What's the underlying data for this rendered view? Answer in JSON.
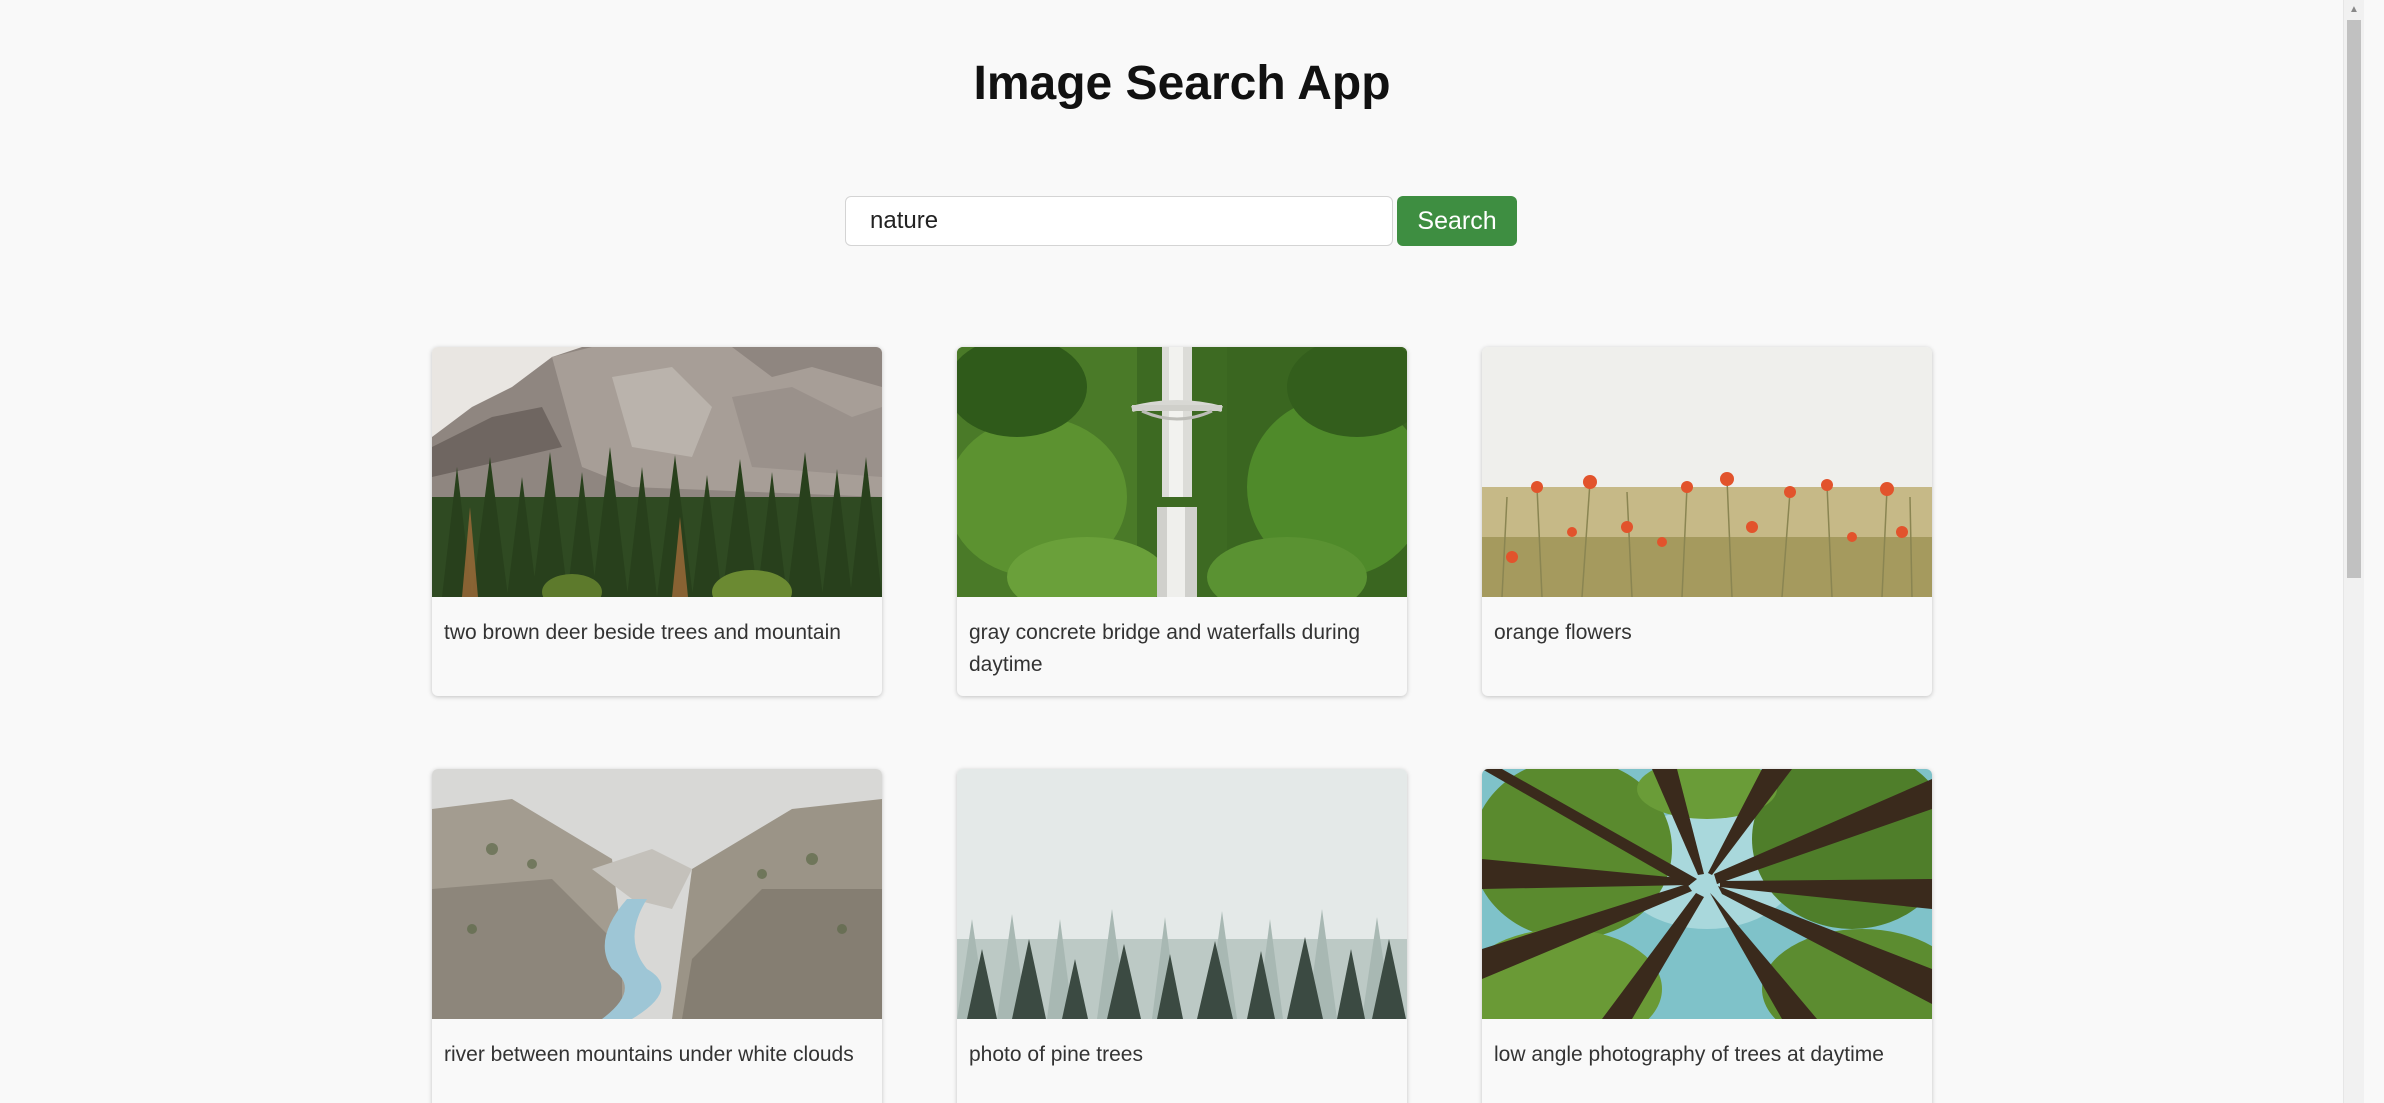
{
  "app": {
    "title": "Image Search App"
  },
  "search": {
    "value": "nature",
    "button_label": "Search"
  },
  "results": [
    {
      "caption": "two brown deer beside trees and mountain",
      "image": "mountain-forest-image"
    },
    {
      "caption": "gray concrete bridge and waterfalls during daytime",
      "image": "waterfall-bridge-image"
    },
    {
      "caption": "orange flowers",
      "image": "poppy-field-image"
    },
    {
      "caption": "river between mountains under white clouds",
      "image": "canyon-river-image"
    },
    {
      "caption": "photo of pine trees",
      "image": "foggy-pine-forest-image"
    },
    {
      "caption": "low angle photography of trees at daytime",
      "image": "tree-canopy-image"
    }
  ],
  "colors": {
    "background": "#f9f9f9",
    "accent": "#3e8e41"
  }
}
